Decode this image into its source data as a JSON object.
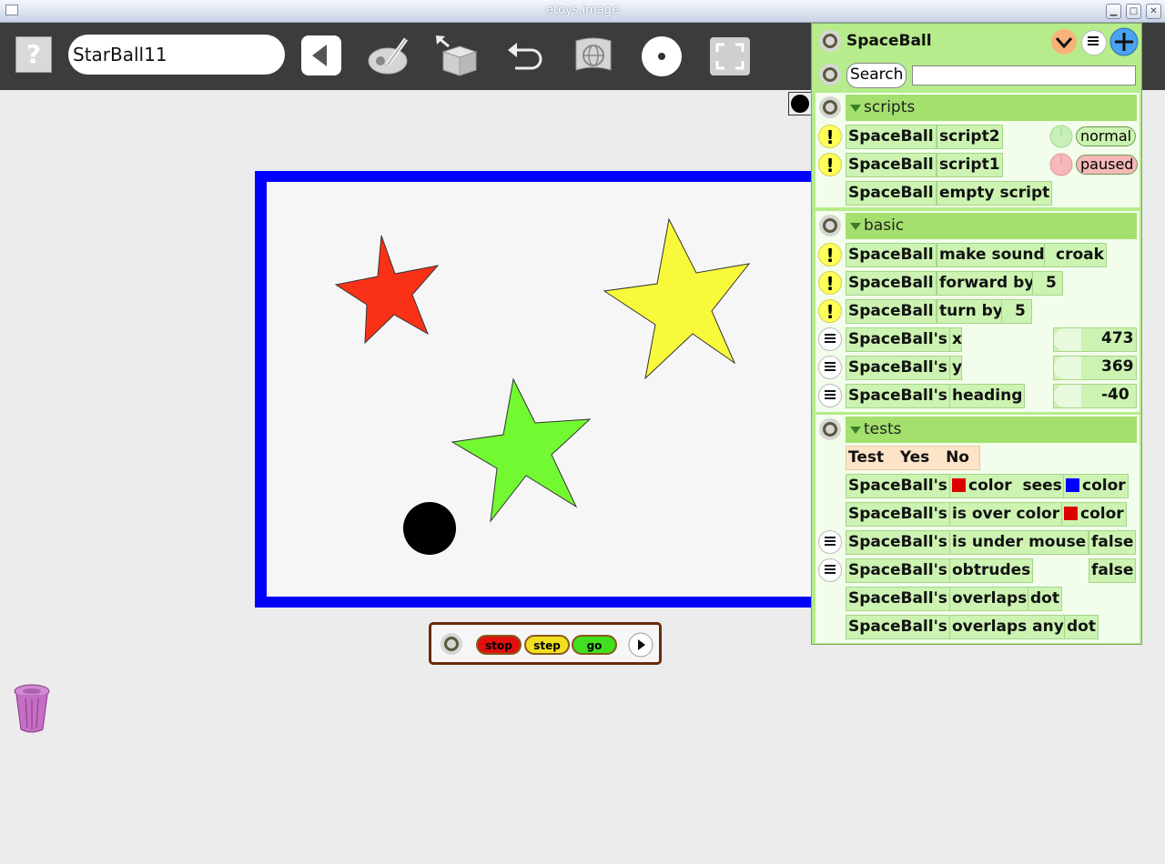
{
  "window": {
    "title": "etoys.image"
  },
  "toolbar": {
    "help_label": "?",
    "project_name": "StarBall11"
  },
  "controls": {
    "stop": "stop",
    "step": "step",
    "go": "go"
  },
  "viewer": {
    "object_name": "SpaceBall",
    "search_label": "Search",
    "search_value": "",
    "scripts": {
      "label": "scripts",
      "rows": [
        {
          "obj": "SpaceBall",
          "script": "script2",
          "status": "normal"
        },
        {
          "obj": "SpaceBall",
          "script": "script1",
          "status": "paused"
        },
        {
          "obj": "SpaceBall",
          "script": "empty script"
        }
      ]
    },
    "basic": {
      "label": "basic",
      "cmd": [
        {
          "obj": "SpaceBall",
          "cmd": "make sound",
          "arg": "croak"
        },
        {
          "obj": "SpaceBall",
          "cmd": "forward by",
          "arg": "5"
        },
        {
          "obj": "SpaceBall",
          "cmd": "turn by",
          "arg": "5"
        }
      ],
      "props": [
        {
          "obj": "SpaceBall's",
          "prop": "x",
          "value": "473"
        },
        {
          "obj": "SpaceBall's",
          "prop": "y",
          "value": "369"
        },
        {
          "obj": "SpaceBall's",
          "prop": "heading",
          "value": "-40"
        }
      ]
    },
    "tests": {
      "label": "tests",
      "test_tile": {
        "test": "Test",
        "yes": "Yes",
        "no": "No"
      },
      "color_sees": {
        "obj": "SpaceBall's",
        "mid": "color  sees",
        "end": "color"
      },
      "over_color": {
        "obj": "SpaceBall's",
        "mid": "is over color",
        "end": "color"
      },
      "under_mouse": {
        "obj": "SpaceBall's",
        "prop": "is under mouse",
        "value": "false"
      },
      "obtrudes": {
        "obj": "SpaceBall's",
        "prop": "obtrudes",
        "value": "false"
      },
      "overlaps": {
        "obj": "SpaceBall's",
        "prop": "overlaps",
        "arg": "dot"
      },
      "overlaps_any": {
        "obj": "SpaceBall's",
        "prop": "overlaps any",
        "arg": "dot"
      }
    }
  },
  "colors": {
    "playfield_border": "#0000ff",
    "red_star": "#f93117",
    "yellow_star": "#f9f93b",
    "green_star": "#72f931",
    "swatch_red": "#dd0000",
    "swatch_blue": "#0000ff"
  }
}
